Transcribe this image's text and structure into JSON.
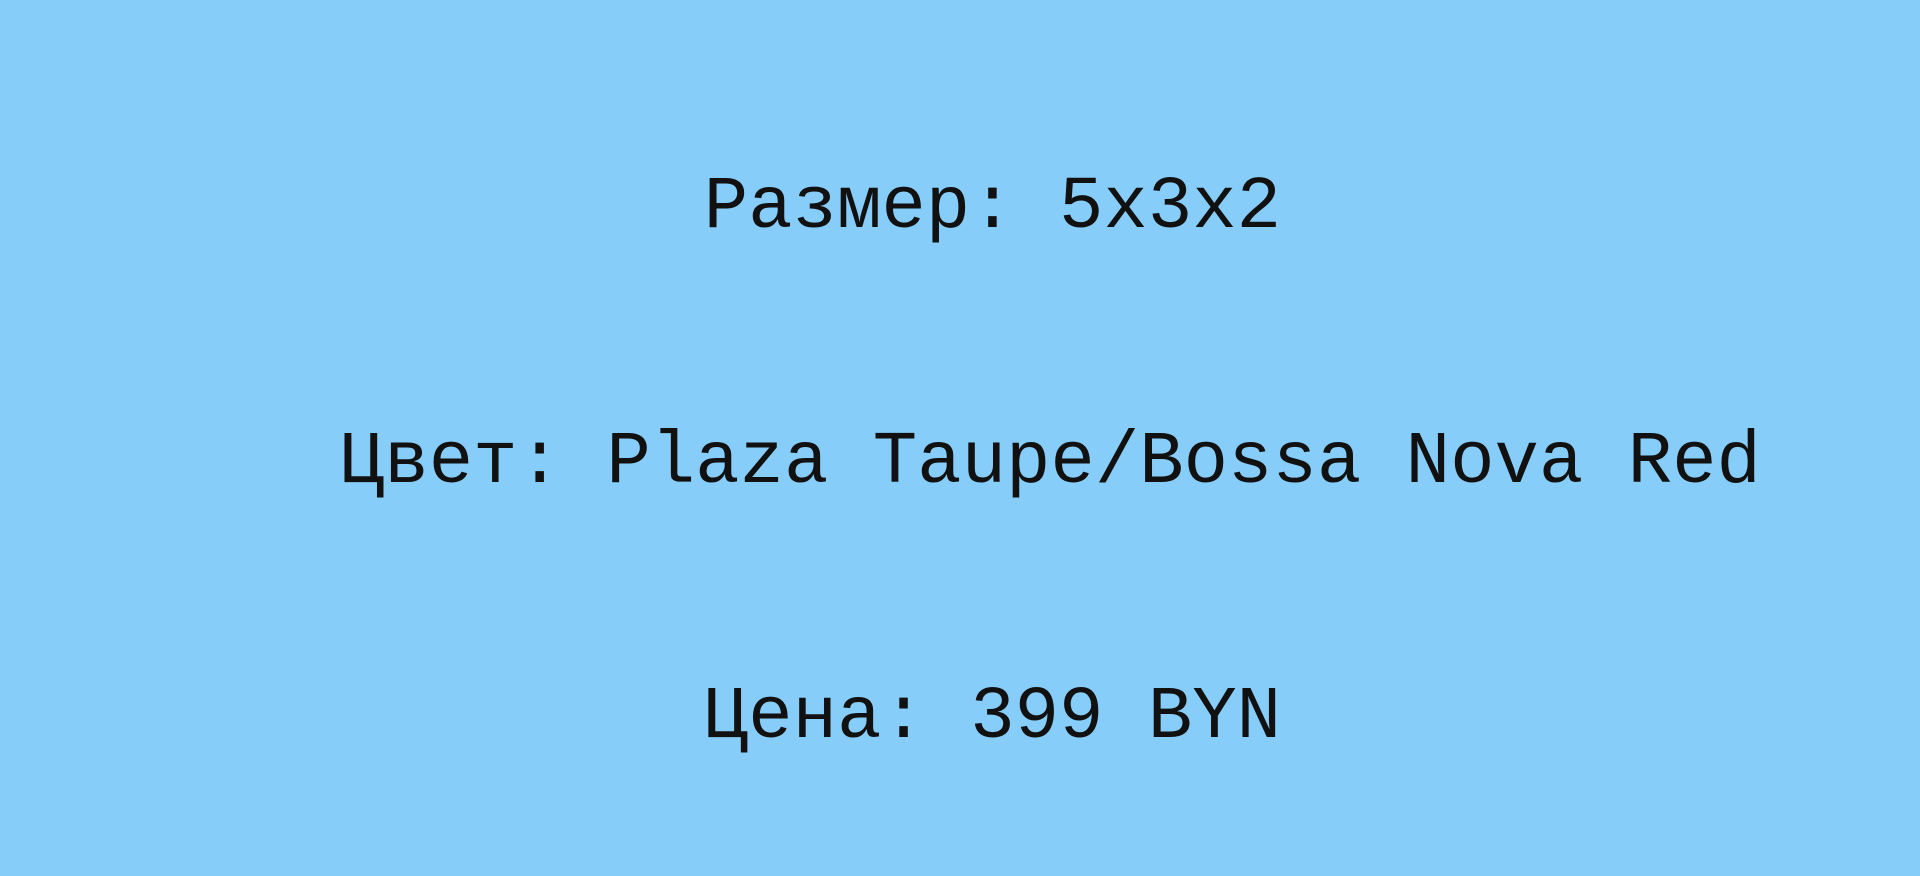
{
  "product": {
    "size_text": "Размер: 5x3x2",
    "color_text": "Цвет: Plaza Taupe/Bossa Nova Red",
    "price_text": "Цена: 399 BYN"
  },
  "colors": {
    "background": "#87cdf9",
    "text": "#111111"
  }
}
